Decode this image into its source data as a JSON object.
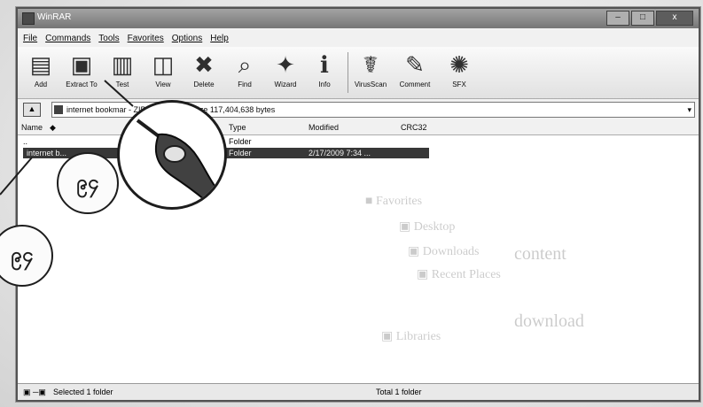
{
  "window": {
    "title": "WinRAR"
  },
  "window_controls": [
    "–",
    "□",
    "x"
  ],
  "menu": [
    "File",
    "Commands",
    "Tools",
    "Favorites",
    "Options",
    "Help"
  ],
  "toolbar": [
    {
      "label": "Add",
      "icon": "books-icon",
      "glyph": "▤"
    },
    {
      "label": "Extract To",
      "icon": "extract-folder-icon",
      "glyph": "▣"
    },
    {
      "label": "Test",
      "icon": "test-book-icon",
      "glyph": "▥"
    },
    {
      "label": "View",
      "icon": "view-glasses-icon",
      "glyph": "◫"
    },
    {
      "label": "Delete",
      "icon": "delete-icon",
      "glyph": "✖"
    },
    {
      "label": "Find",
      "icon": "find-binoculars-icon",
      "glyph": "⌕"
    },
    {
      "label": "Wizard",
      "icon": "wizard-icon",
      "glyph": "✦"
    },
    {
      "label": "Info",
      "icon": "info-icon",
      "glyph": "ℹ"
    },
    {
      "label": "VirusScan",
      "icon": "virus-scan-icon",
      "glyph": "☤"
    },
    {
      "label": "Comment",
      "icon": "comment-pen-icon",
      "glyph": "✎"
    },
    {
      "label": "SFX",
      "icon": "sfx-icon",
      "glyph": "✺"
    }
  ],
  "address": {
    "text": "internet bookmar - ZIP ... unpacked size 117,404,638 bytes"
  },
  "columns": [
    "Name",
    "Type",
    "Modified",
    "CRC32"
  ],
  "rows": [
    {
      "name": "..",
      "type": "Folder",
      "modified": ""
    },
    {
      "name": "internet b...",
      "type": "Folder",
      "modified": "2/17/2009 7:34 ..."
    }
  ],
  "status": {
    "left": "Selected 1 folder",
    "right": "Total 1 folder"
  },
  "callout": {
    "number": "၉၄"
  }
}
